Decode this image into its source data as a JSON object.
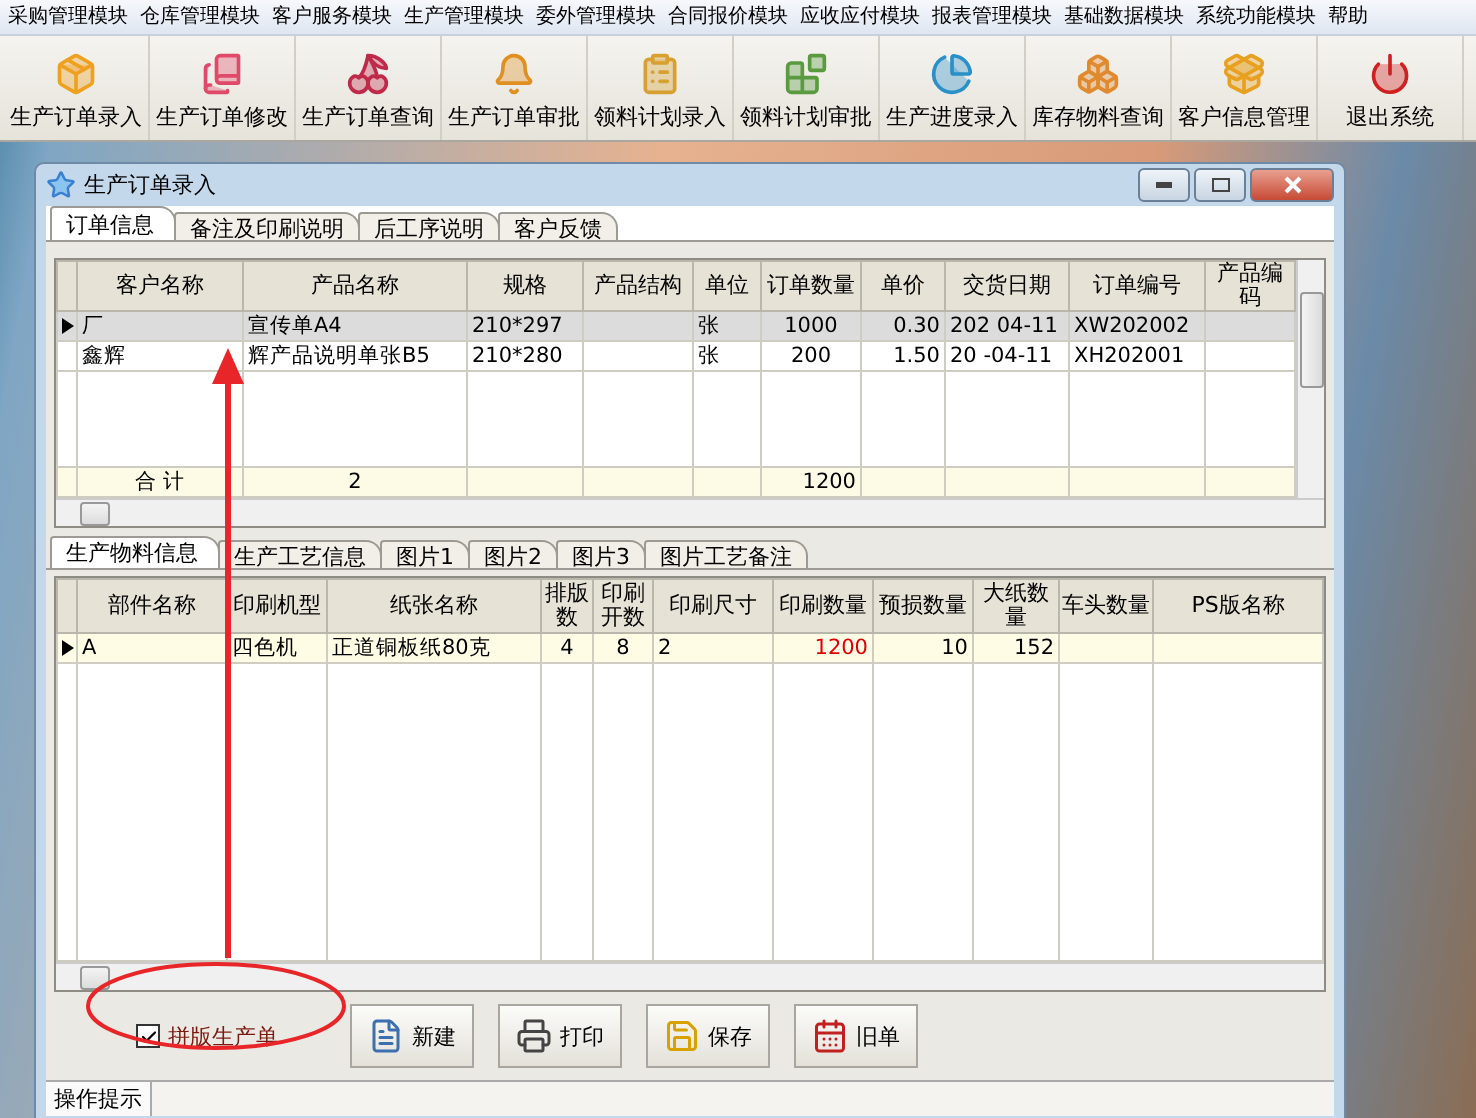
{
  "menu": {
    "items": [
      "采购管理模块",
      "仓库管理模块",
      "客户服务模块",
      "生产管理模块",
      "委外管理模块",
      "合同报价模块",
      "应收应付模块",
      "报表管理模块",
      "基础数据模块",
      "系统功能模块",
      "帮助"
    ]
  },
  "toolbar": [
    {
      "label": "生产订单录入"
    },
    {
      "label": "生产订单修改"
    },
    {
      "label": "生产订单查询"
    },
    {
      "label": "生产订单审批"
    },
    {
      "label": "领料计划录入"
    },
    {
      "label": "领料计划审批"
    },
    {
      "label": "生产进度录入"
    },
    {
      "label": "库存物料查询"
    },
    {
      "label": "客户信息管理"
    },
    {
      "label": "退出系统"
    }
  ],
  "window": {
    "title": "生产订单录入",
    "tabs": [
      {
        "label": "订单信息",
        "selected": true
      },
      {
        "label": "备注及印刷说明",
        "selected": false
      },
      {
        "label": "后工序说明",
        "selected": false
      },
      {
        "label": "客户反馈",
        "selected": false
      }
    ],
    "order_grid": {
      "columns": [
        {
          "label": "客户名称",
          "total": "合 计"
        },
        {
          "label": "产品名称",
          "total": "2"
        },
        {
          "label": "规格"
        },
        {
          "label": "产品结构"
        },
        {
          "label": "单位"
        },
        {
          "label": "订单数量",
          "total": "1200"
        },
        {
          "label": "单价"
        },
        {
          "label": "交货日期"
        },
        {
          "label": "订单编号"
        },
        {
          "label": "产品编码"
        }
      ],
      "rows": [
        {
          "selected": true,
          "cells": [
            "厂",
            "宣传单A4",
            "210*297",
            null,
            "张",
            "1000",
            "0.30",
            "202 04-11",
            "XW202002",
            null
          ]
        },
        {
          "selected": false,
          "cells": [
            "鑫辉",
            "辉产品说明单张B5",
            "210*280",
            null,
            "张",
            "200",
            "1.50",
            "20 -04-11",
            "XH202001",
            null
          ]
        }
      ]
    },
    "detail_tabs": [
      {
        "label": "生产物料信息",
        "selected": true
      },
      {
        "label": "生产工艺信息",
        "selected": false
      },
      {
        "label": "图片1",
        "selected": false
      },
      {
        "label": "图片2",
        "selected": false
      },
      {
        "label": "图片3",
        "selected": false
      },
      {
        "label": "图片工艺备注",
        "selected": false
      }
    ],
    "material_grid": {
      "columns": [
        {
          "label": "部件名称",
          "emphasis": false
        },
        {
          "label": "印刷机型",
          "emphasis": false
        },
        {
          "label": "纸张名称",
          "emphasis": false
        },
        {
          "label": "排版数",
          "emphasis": false
        },
        {
          "label": "印刷开数",
          "emphasis": false
        },
        {
          "label": "印刷尺寸",
          "emphasis": false
        },
        {
          "label": "印刷数量",
          "emphasis": true
        },
        {
          "label": "预损数量",
          "emphasis": false
        },
        {
          "label": "大纸数量",
          "emphasis": false
        },
        {
          "label": "车头数量",
          "emphasis": false
        },
        {
          "label": "PS版名称",
          "emphasis": false
        }
      ],
      "rows": [
        {
          "selected": true,
          "cells": [
            "A",
            "四色机",
            "正道铜板纸80克",
            "4",
            "8",
            "2",
            "1200",
            "10",
            "152",
            null,
            null
          ]
        }
      ]
    },
    "imposition_checkbox": {
      "label": "拼版生产单",
      "checked": true
    },
    "buttons": [
      {
        "label": "新建",
        "kind": "new"
      },
      {
        "label": "打印",
        "kind": "print"
      },
      {
        "label": "保存",
        "kind": "save"
      },
      {
        "label": "旧单",
        "kind": "old"
      }
    ],
    "status_bar": {
      "label": "操作提示"
    }
  }
}
